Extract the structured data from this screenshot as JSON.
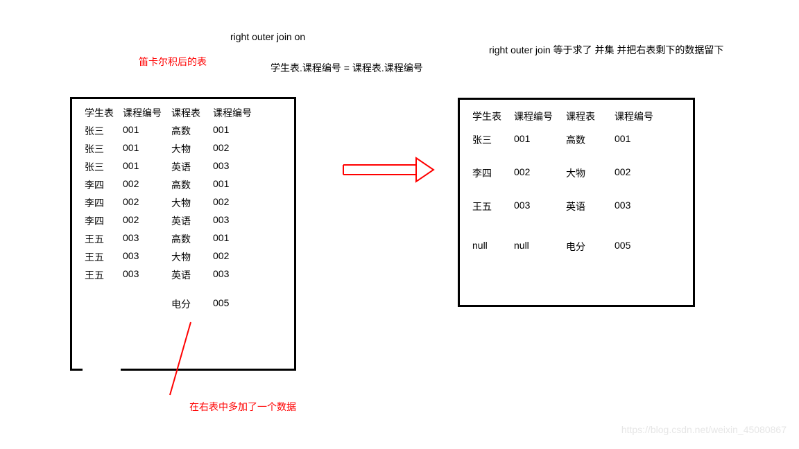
{
  "labels": {
    "top1": "right  outer  join on",
    "top2": "right outer   join 等于求了    并集 并把右表剩下的数据留下",
    "red1": "笛卡尔积后的表",
    "cond": "学生表.课程编号 =  课程表.课程编号",
    "red2": "在右表中多加了一个数据",
    "watermark": "https://blog.csdn.net/weixin_45080867"
  },
  "left": {
    "headers": [
      "学生表",
      "课程编号",
      "课程表",
      "课程编号"
    ],
    "rows": [
      [
        "张三",
        "001",
        "高数",
        "001"
      ],
      [
        "张三",
        "001",
        "大物",
        "002"
      ],
      [
        "张三",
        "001",
        "英语",
        "003"
      ],
      [
        "李四",
        "002",
        "高数",
        "001"
      ],
      [
        "李四",
        "002",
        "大物",
        "002"
      ],
      [
        "李四",
        "002",
        "英语",
        "003"
      ],
      [
        "王五",
        "003",
        "高数",
        "001"
      ],
      [
        "王五",
        "003",
        "大物",
        "002"
      ],
      [
        "王五",
        "003",
        "英语",
        "003"
      ]
    ],
    "extra": [
      "",
      "",
      "电分",
      "005"
    ]
  },
  "right": {
    "headers": [
      "学生表",
      "课程编号",
      "课程表",
      "课程编号"
    ],
    "rows": [
      [
        "张三",
        "001",
        "高数",
        "001"
      ],
      [
        "李四",
        "002",
        "大物",
        "002"
      ],
      [
        "王五",
        "003",
        "英语",
        "003"
      ],
      [
        "null",
        "null",
        "电分",
        "005"
      ]
    ]
  }
}
